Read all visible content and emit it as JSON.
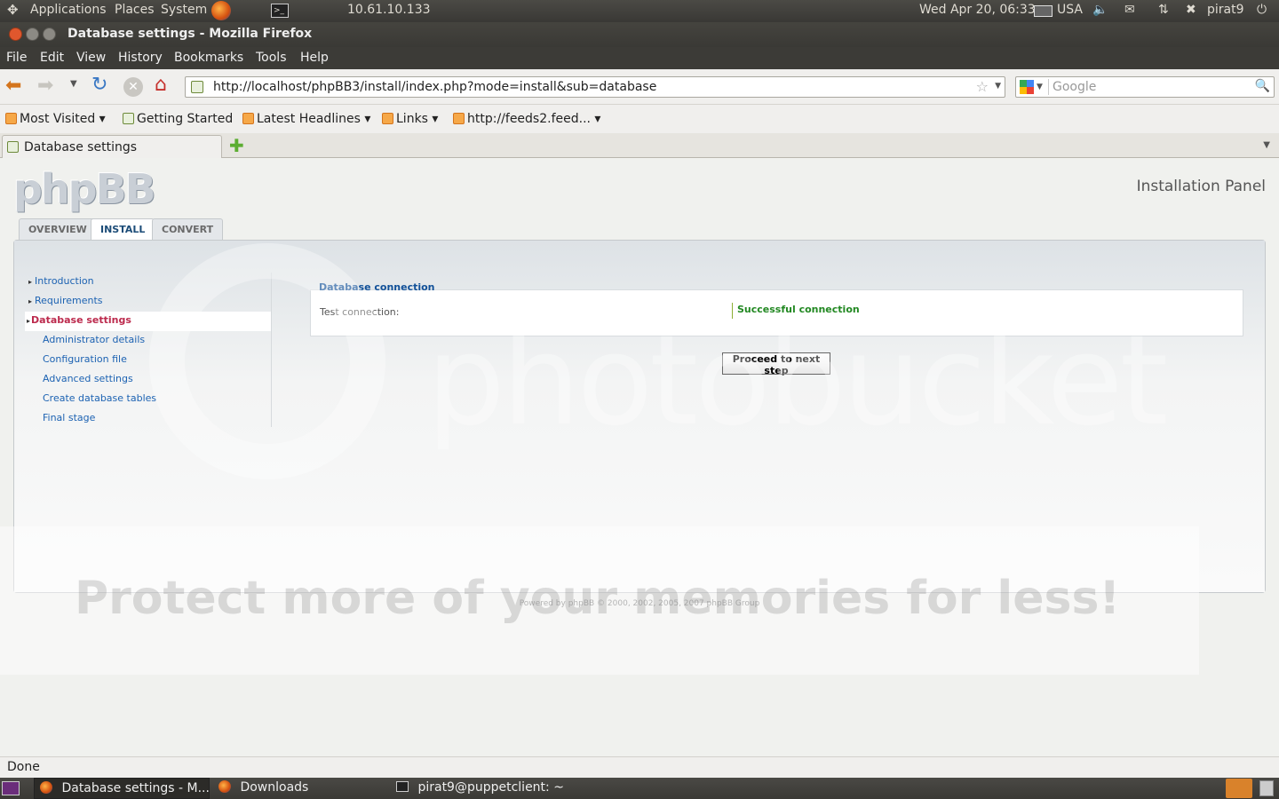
{
  "gnome_panel": {
    "menus": [
      "Applications",
      "Places",
      "System"
    ],
    "ip": "10.61.10.133",
    "datetime": "Wed Apr 20, 06:33",
    "keyboard": "USA",
    "user": "pirat9"
  },
  "window": {
    "title": "Database settings - Mozilla Firefox"
  },
  "menubar": [
    "File",
    "Edit",
    "View",
    "History",
    "Bookmarks",
    "Tools",
    "Help"
  ],
  "navigation": {
    "url": "http://localhost/phpBB3/install/index.php?mode=install&sub=database",
    "search_placeholder": "Google"
  },
  "bookmarks": [
    "Most Visited",
    "Getting Started",
    "Latest Headlines",
    "Links",
    "http://feeds2.feed..."
  ],
  "tab": {
    "title": "Database settings"
  },
  "page": {
    "logo": "phpBB",
    "panel_title": "Installation Panel",
    "tabs": [
      "OVERVIEW",
      "INSTALL",
      "CONVERT"
    ],
    "steps_done": [
      "Introduction",
      "Requirements"
    ],
    "step_current": "Database settings",
    "steps_todo": [
      "Administrator details",
      "Configuration file",
      "Advanced settings",
      "Create database tables",
      "Final stage"
    ],
    "fieldset_legend": "Database connection",
    "test_label": "Test connection:",
    "test_result": "Successful connection",
    "proceed_button": "Proceed to next step",
    "footer": "Powered by phpBB © 2000, 2002, 2005, 2007 phpBB Group"
  },
  "watermark": {
    "brand": "photobucket",
    "slogan": "Protect more of your memories for less!"
  },
  "status": "Done",
  "taskbar": [
    "Database settings - M...",
    "Downloads",
    "pirat9@puppetclient: ~"
  ],
  "colors": {
    "link": "#1c62b2",
    "current_step": "#bc2a4d",
    "success": "#228822"
  }
}
